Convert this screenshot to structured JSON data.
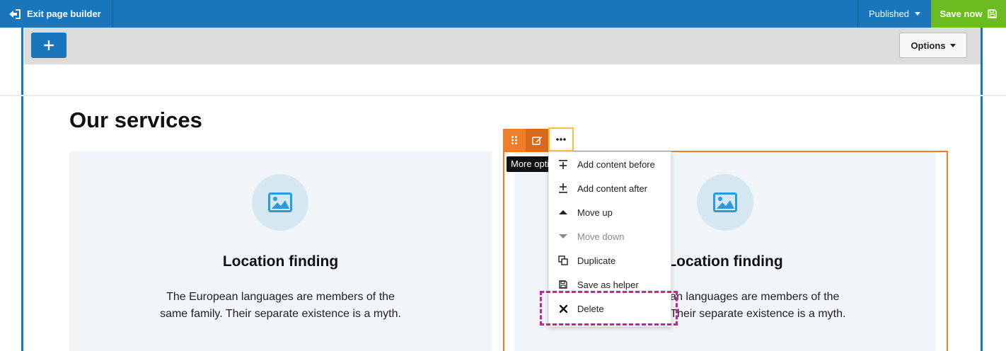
{
  "topbar": {
    "exit_label": "Exit page builder",
    "status_label": "Published",
    "save_label": "Save now",
    "color": "#1976bd",
    "save_color": "#6cbb21"
  },
  "builder": {
    "add_icon": "plus-icon",
    "options_label": "Options"
  },
  "page": {
    "title": "Our services",
    "cards": [
      {
        "icon": "image-icon",
        "title": "Location finding",
        "text": "The European languages are members of the same family. Their separate existence is a myth."
      },
      {
        "icon": "image-icon",
        "title": "Location finding",
        "text": "The European languages are members of the same family. Their separate existence is a myth."
      }
    ]
  },
  "element_toolbar": {
    "drag_icon": "drag-handle-icon",
    "edit_icon": "edit-icon",
    "more_icon": "ellipsis-icon",
    "tooltip": "More options",
    "accent": "#f07d29"
  },
  "menu": {
    "items": [
      {
        "label": "Add content before",
        "icon": "insert-before-icon",
        "enabled": true
      },
      {
        "label": "Add content after",
        "icon": "insert-after-icon",
        "enabled": true
      },
      {
        "label": "Move up",
        "icon": "triangle-up-icon",
        "enabled": true
      },
      {
        "label": "Move down",
        "icon": "triangle-down-icon",
        "enabled": false
      },
      {
        "label": "Duplicate",
        "icon": "duplicate-icon",
        "enabled": true
      },
      {
        "label": "Save as helper",
        "icon": "save-icon",
        "enabled": true
      },
      {
        "label": "Delete",
        "icon": "close-icon",
        "enabled": true
      }
    ],
    "highlight_color": "#d11aa6"
  }
}
